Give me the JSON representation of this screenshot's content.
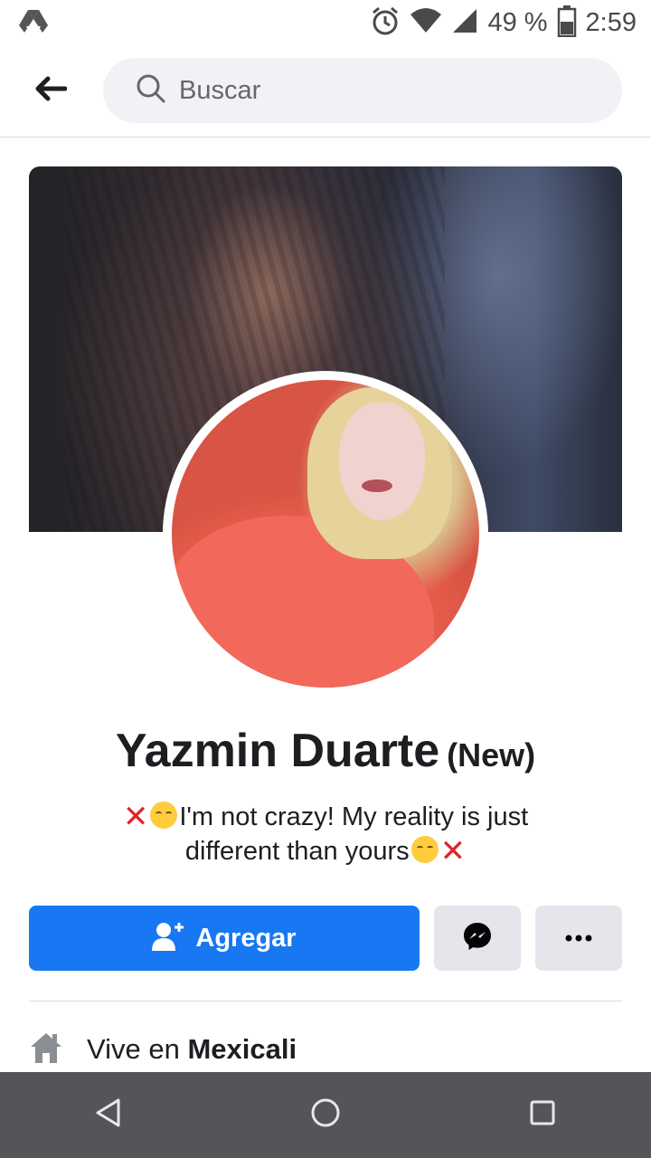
{
  "status_bar": {
    "battery_percent": "49 %",
    "time": "2:59",
    "icons": [
      "drive-icon",
      "alarm-icon",
      "wifi-icon",
      "signal-icon",
      "battery-icon"
    ]
  },
  "top_nav": {
    "back_icon": "arrow-left-icon",
    "search_placeholder": "Buscar"
  },
  "profile": {
    "name": "Yazmin Duarte",
    "name_tag": "(New)",
    "bio_line1": "I'm not crazy! My reality is just",
    "bio_line2": "different than yours"
  },
  "actions": {
    "add_label": "Agregar",
    "add_icon": "add-friend-icon",
    "message_icon": "messenger-icon",
    "more_icon": "more-dots-icon",
    "accent": "#1877f2"
  },
  "info": {
    "lives_prefix": "Vive en",
    "lives_city": "Mexicali",
    "icon": "home-icon"
  },
  "system_nav": {
    "icons": [
      "back-triangle-icon",
      "home-circle-icon",
      "recents-square-icon"
    ]
  }
}
